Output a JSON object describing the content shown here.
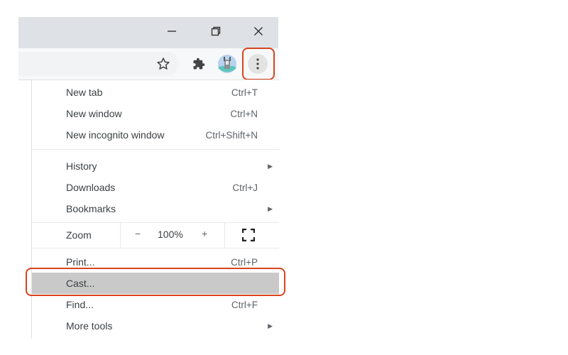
{
  "window": {
    "minimize_icon": "minimize-icon",
    "restore_icon": "restore-icon",
    "close_icon": "close-icon"
  },
  "toolbar": {
    "bookmark_icon": "star-icon",
    "extensions_icon": "puzzle-icon",
    "profile_icon": "avatar",
    "menu_icon": "kebab-menu-icon"
  },
  "menu": {
    "group1": [
      {
        "label": "New tab",
        "shortcut": "Ctrl+T"
      },
      {
        "label": "New window",
        "shortcut": "Ctrl+N"
      },
      {
        "label": "New incognito window",
        "shortcut": "Ctrl+Shift+N"
      }
    ],
    "group2": [
      {
        "label": "History",
        "submenu": "▶"
      },
      {
        "label": "Downloads",
        "shortcut": "Ctrl+J"
      },
      {
        "label": "Bookmarks",
        "submenu": "▶"
      }
    ],
    "zoom": {
      "label": "Zoom",
      "minus": "−",
      "value": "100%",
      "plus": "+"
    },
    "group3": [
      {
        "label": "Print...",
        "shortcut": "Ctrl+P"
      },
      {
        "label": "Cast...",
        "highlighted": true
      },
      {
        "label": "Find...",
        "shortcut": "Ctrl+F"
      },
      {
        "label": "More tools",
        "submenu": "▶"
      }
    ]
  },
  "annotations": {
    "color": "#d9441f"
  }
}
